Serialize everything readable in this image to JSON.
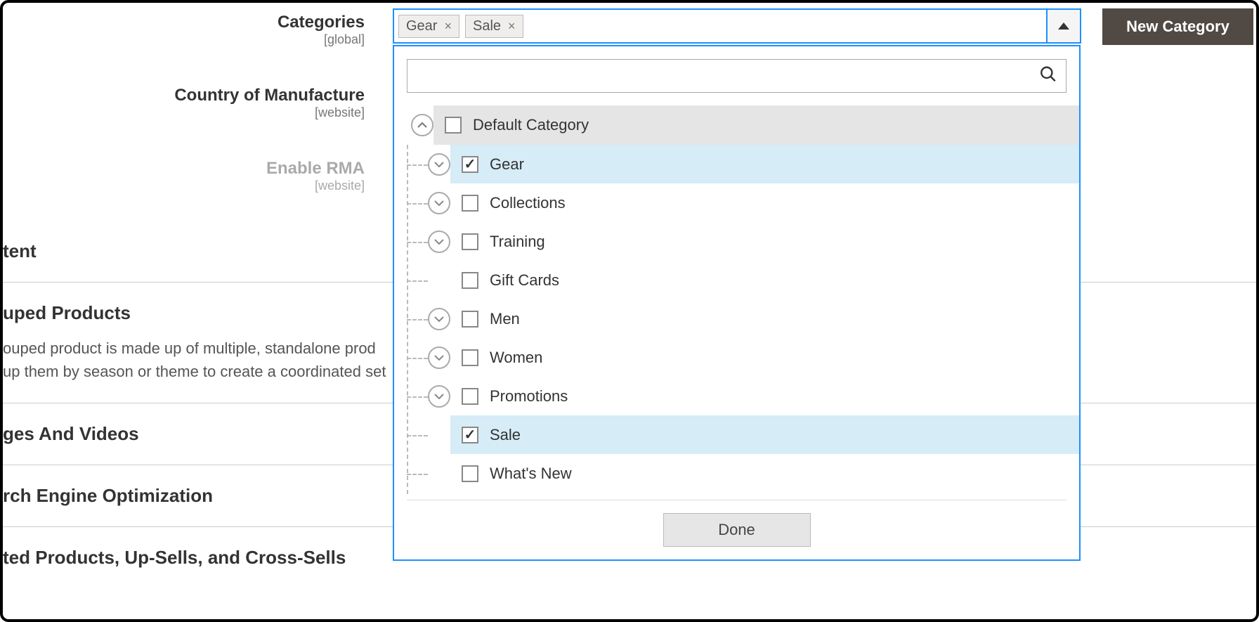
{
  "fields": {
    "categories": {
      "label": "Categories",
      "scope": "[global]"
    },
    "country": {
      "label": "Country of Manufacture",
      "scope": "[website]"
    },
    "rma": {
      "label": "Enable RMA",
      "scope": "[website]"
    }
  },
  "multiselect": {
    "chips": [
      {
        "label": "Gear"
      },
      {
        "label": "Sale"
      }
    ],
    "search_placeholder": "",
    "done_label": "Done"
  },
  "tree": {
    "root": {
      "label": "Default Category",
      "checked": false,
      "expanded": true
    },
    "children": [
      {
        "label": "Gear",
        "checked": true,
        "expandable": true
      },
      {
        "label": "Collections",
        "checked": false,
        "expandable": true
      },
      {
        "label": "Training",
        "checked": false,
        "expandable": true
      },
      {
        "label": "Gift Cards",
        "checked": false,
        "expandable": false
      },
      {
        "label": "Men",
        "checked": false,
        "expandable": true
      },
      {
        "label": "Women",
        "checked": false,
        "expandable": true
      },
      {
        "label": "Promotions",
        "checked": false,
        "expandable": true
      },
      {
        "label": "Sale",
        "checked": true,
        "expandable": false
      },
      {
        "label": "What's New",
        "checked": false,
        "expandable": false
      }
    ]
  },
  "new_category_label": "New Category",
  "sections": {
    "content": "tent",
    "grouped": {
      "title": "uped Products",
      "desc_line1": "ouped product is made up of multiple, standalone prod",
      "desc_line2": "up them by season or theme to create a coordinated set"
    },
    "images": "ges And Videos",
    "seo": "rch Engine Optimization",
    "related": "ted Products, Up-Sells, and Cross-Sells"
  }
}
